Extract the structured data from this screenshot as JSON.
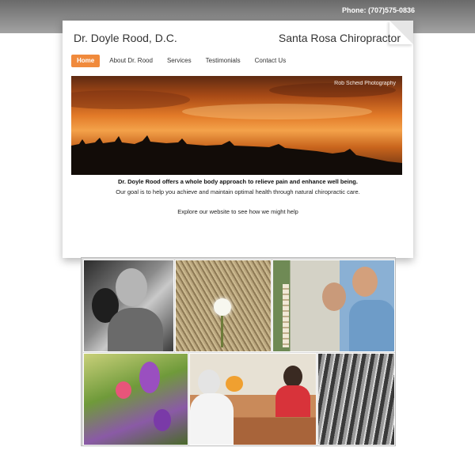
{
  "header": {
    "phone": "Phone: (707)575-0836"
  },
  "site": {
    "title": "Dr. Doyle Rood, D.C.",
    "tagline": "Santa Rosa Chiropractor"
  },
  "nav": {
    "items": [
      "Home",
      "About Dr. Rood",
      "Services",
      "Testimonials",
      "Contact Us"
    ],
    "active": "Home"
  },
  "hero": {
    "credit": "Rob Scheid Photography"
  },
  "intro": {
    "headline": "Dr. Doyle Rood offers a whole body approach to relieve pain and enhance well being.",
    "body": "Our goal is to help you achieve and maintain optimal health through natural chiropractic care.",
    "explore": "Explore our website to see how we might help"
  },
  "colors": {
    "accent": "#f08a3c",
    "topbar": "#7a7a7a"
  }
}
